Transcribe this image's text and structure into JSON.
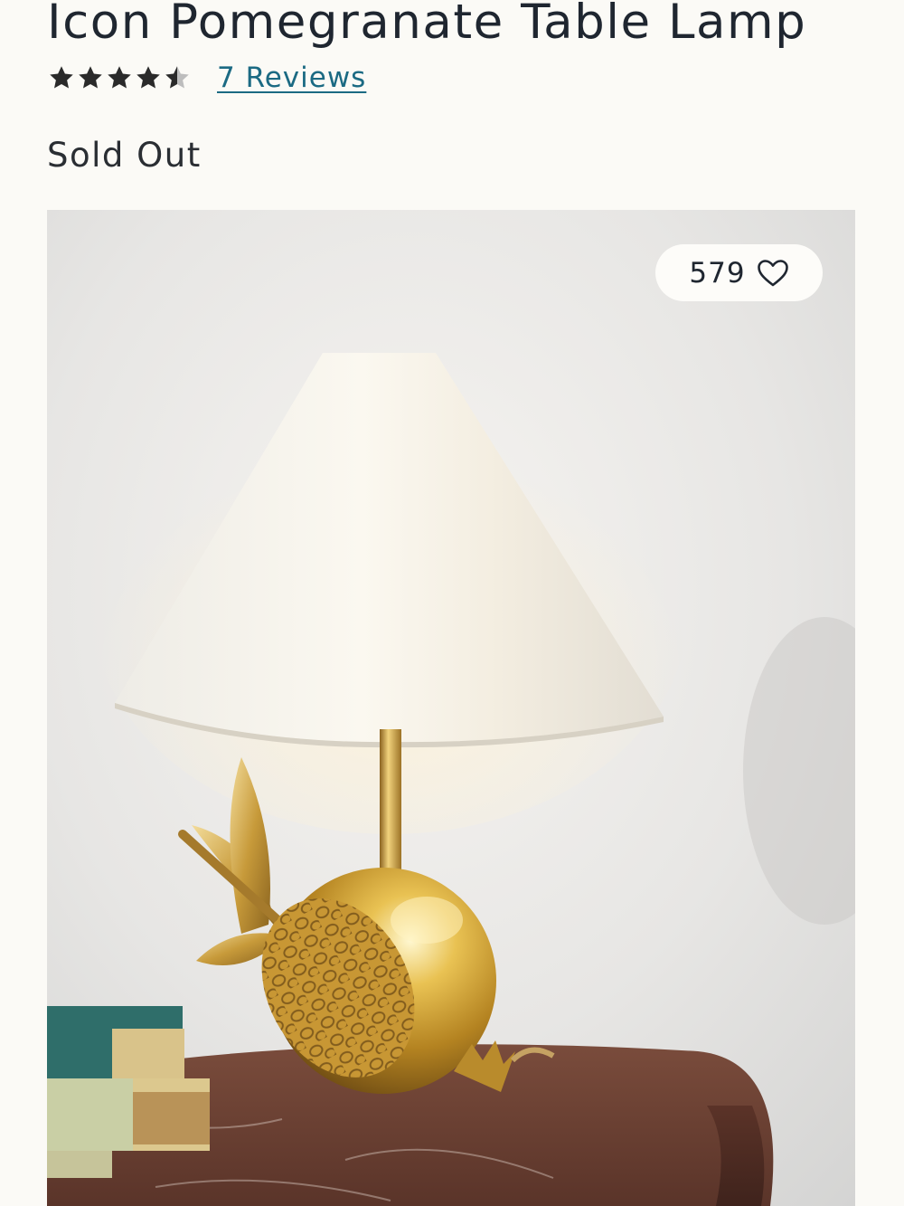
{
  "product": {
    "title": "Icon Pomegranate Table Lamp",
    "rating": 4.5,
    "rating_max": 5,
    "reviews_label": "7 Reviews",
    "availability": "Sold Out"
  },
  "image": {
    "alt": "Icon Pomegranate Table Lamp",
    "favorite_count": "579",
    "favorite_icon": "heart-outline-icon"
  },
  "colors": {
    "text": "#1f2630",
    "link": "#1b6a83",
    "background": "#fbfaf6",
    "star": "#2a2a2a"
  }
}
